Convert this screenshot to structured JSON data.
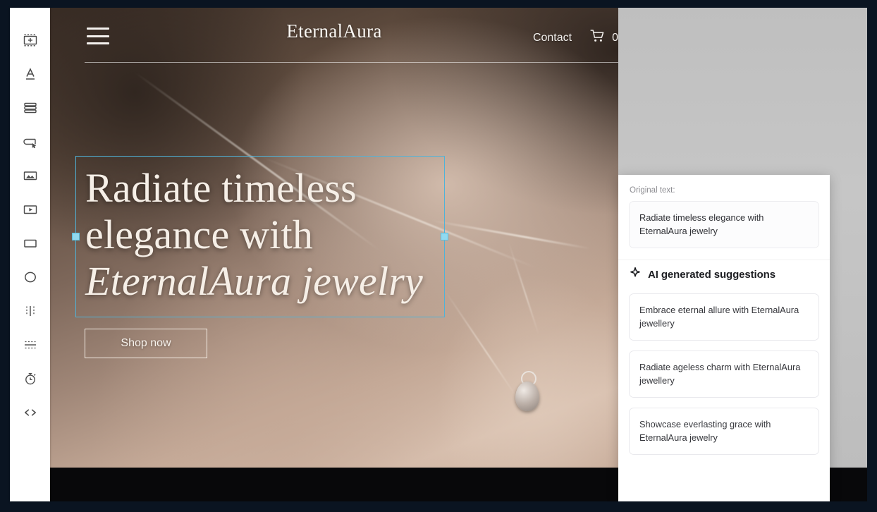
{
  "tool_rail": {
    "items": [
      {
        "name": "add-section-icon",
        "label": "Add section"
      },
      {
        "name": "text-icon",
        "label": "Text"
      },
      {
        "name": "layers-icon",
        "label": "Layers"
      },
      {
        "name": "button-link-icon",
        "label": "Button"
      },
      {
        "name": "image-icon",
        "label": "Image"
      },
      {
        "name": "video-icon",
        "label": "Video"
      },
      {
        "name": "box-icon",
        "label": "Box"
      },
      {
        "name": "ellipse-icon",
        "label": "Ellipse"
      },
      {
        "name": "divider-vertical-icon",
        "label": "Vertical divider"
      },
      {
        "name": "spacer-icon",
        "label": "Spacer"
      },
      {
        "name": "timer-icon",
        "label": "Countdown timer"
      },
      {
        "name": "embed-code-icon",
        "label": "Embed code"
      }
    ]
  },
  "site": {
    "logo": "EternalAura",
    "nav": {
      "menu_icon": "hamburger-icon",
      "contact_label": "Contact",
      "cart_icon": "shopping-cart-icon",
      "cart_count": "0"
    },
    "hero": {
      "headline_line1": "Radiate timeless",
      "headline_line2": "elegance with",
      "headline_accent": "EternalAura jewelry",
      "cta_label": "Shop now"
    }
  },
  "ai_panel": {
    "original_label": "Original text:",
    "original_text": "Radiate timeless elegance with EternalAura jewelry",
    "heading": "AI generated suggestions",
    "heading_icon": "sparkle-icon",
    "suggestions": [
      "Embrace eternal allure with EternalAura jewellery",
      "Radiate ageless charm with EternalAura jewellery",
      "Showcase everlasting grace with EternalAura jewelry"
    ]
  },
  "selection": {
    "handle_color": "#92d9ef",
    "outline_color": "#4fb3d9"
  }
}
